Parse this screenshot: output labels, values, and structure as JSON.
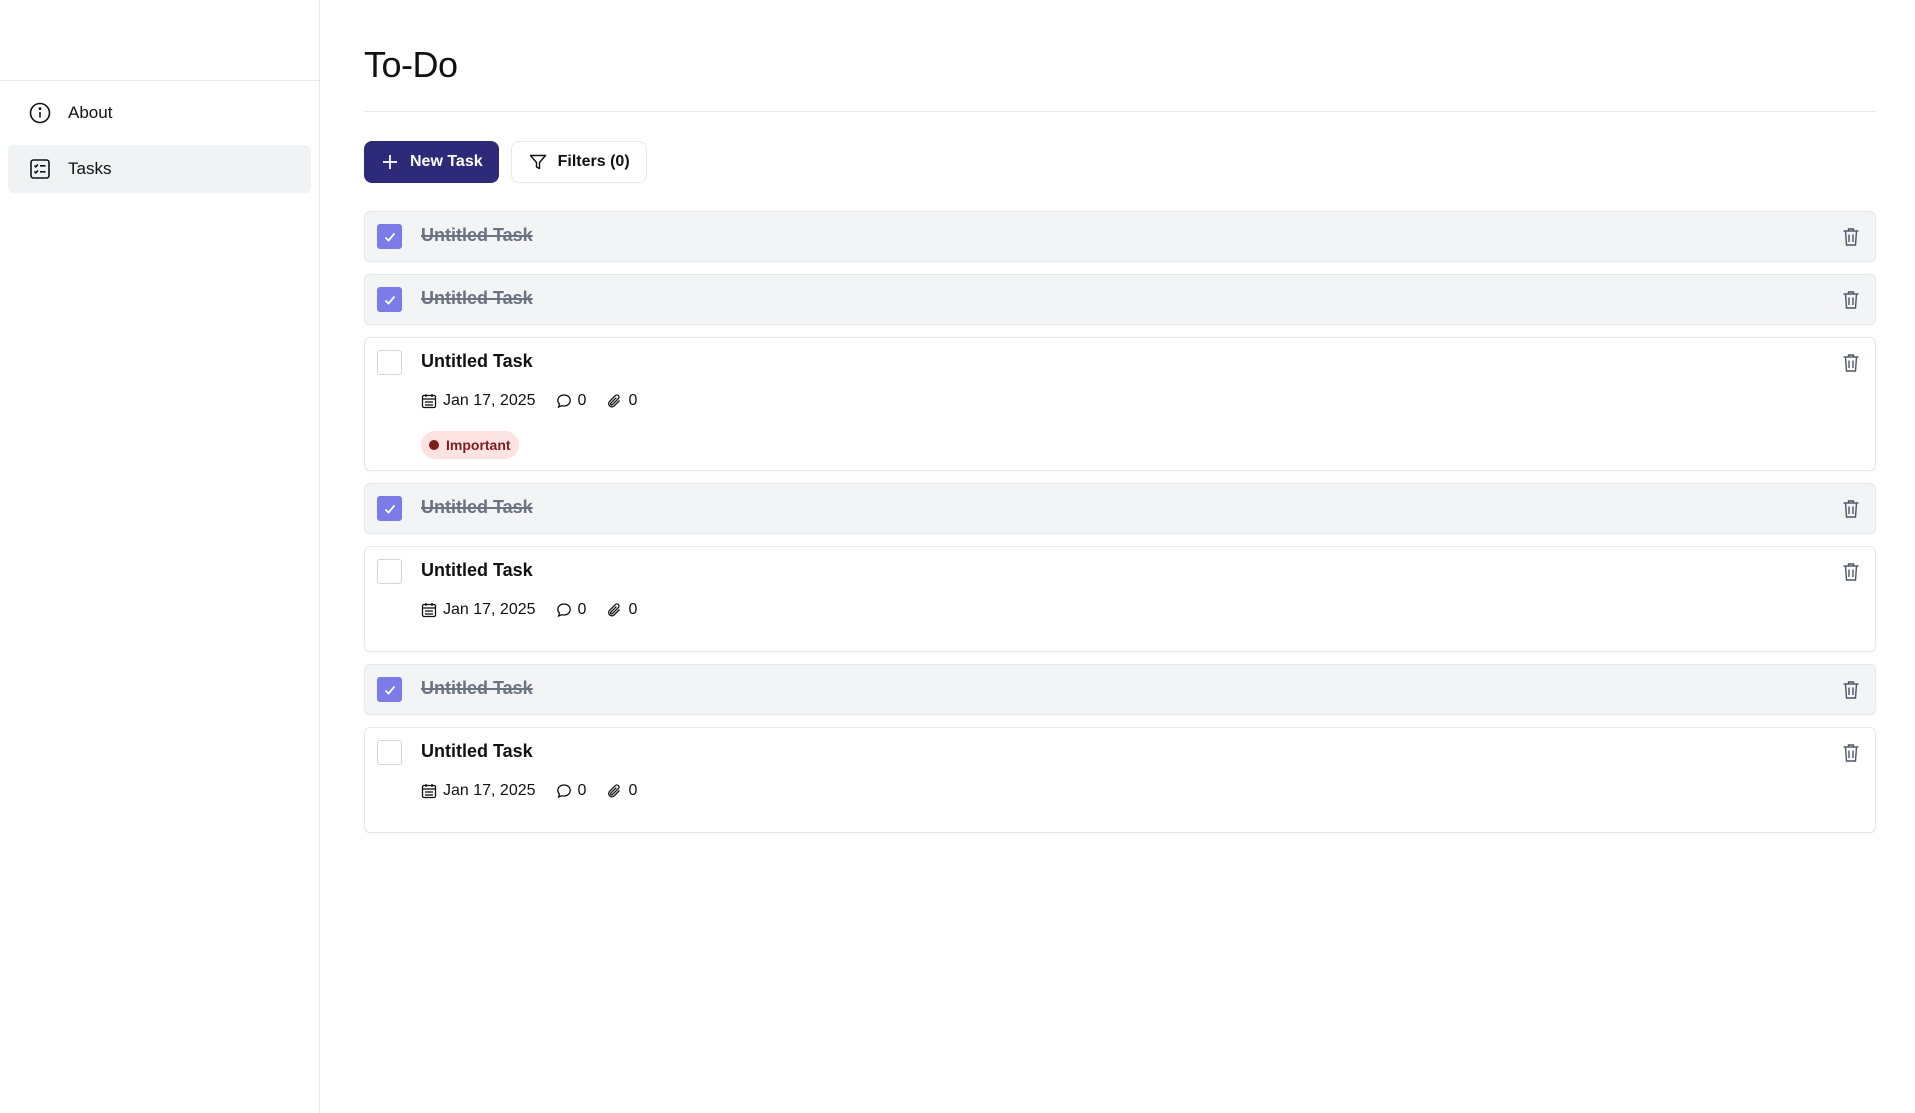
{
  "sidebar": {
    "items": [
      {
        "label": "About",
        "icon": "info-icon",
        "active": false
      },
      {
        "label": "Tasks",
        "icon": "checklist-icon",
        "active": true
      }
    ]
  },
  "main": {
    "title": "To-Do",
    "toolbar": {
      "new_task_label": "New Task",
      "filters_label": "Filters (0)"
    },
    "tasks": [
      {
        "title": "Untitled Task",
        "completed": true
      },
      {
        "title": "Untitled Task",
        "completed": true
      },
      {
        "title": "Untitled Task",
        "completed": false,
        "date": "Jan 17, 2025",
        "comments": "0",
        "attachments": "0",
        "badge": "Important"
      },
      {
        "title": "Untitled Task",
        "completed": true
      },
      {
        "title": "Untitled Task",
        "completed": false,
        "date": "Jan 17, 2025",
        "comments": "0",
        "attachments": "0"
      },
      {
        "title": "Untitled Task",
        "completed": true
      },
      {
        "title": "Untitled Task",
        "completed": false,
        "date": "Jan 17, 2025",
        "comments": "0",
        "attachments": "0"
      }
    ]
  },
  "colors": {
    "primary": "#2e2a7a",
    "checkbox_checked": "#7b7ce8",
    "completed_bg": "#f3f4f6",
    "badge_bg": "#fde2e2",
    "badge_text": "#7f1d1d"
  }
}
